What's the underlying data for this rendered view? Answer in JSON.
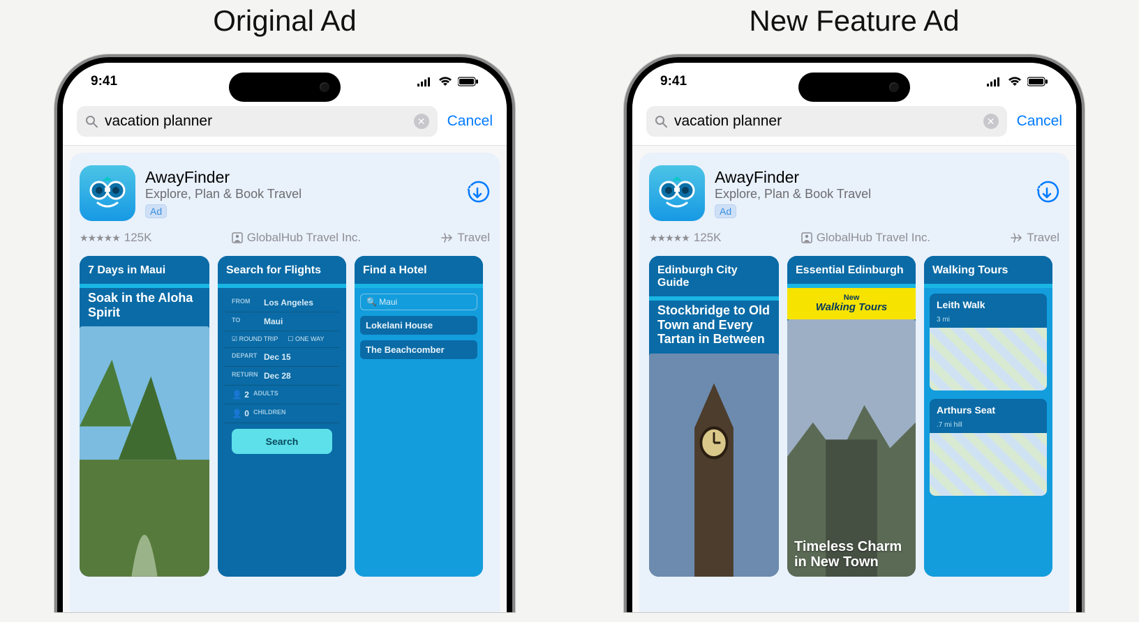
{
  "labels": {
    "left": "Original Ad",
    "right": "New Feature Ad"
  },
  "status": {
    "time": "9:41"
  },
  "search": {
    "query": "vacation planner",
    "cancel": "Cancel"
  },
  "app": {
    "name": "AwayFinder",
    "subtitle": "Explore, Plan & Book Travel",
    "ad_badge": "Ad",
    "ratings_count": "125K",
    "developer": "GlobalHub Travel Inc.",
    "category": "Travel"
  },
  "left_shots": {
    "s1": {
      "title": "7 Days in Maui",
      "subtitle": "Soak in the Aloha Spirit"
    },
    "s2": {
      "title": "Search for Flights",
      "from_label": "FROM",
      "from": "Los Angeles",
      "to_label": "TO",
      "to": "Maui",
      "round": "ROUND TRIP",
      "oneway": "ONE WAY",
      "depart_label": "DEPART",
      "depart": "Dec 15",
      "return_label": "RETURN",
      "return": "Dec 28",
      "adults_n": "2",
      "adults": "ADULTS",
      "kids_n": "0",
      "kids": "CHILDREN",
      "button": "Search"
    },
    "s3": {
      "title": "Find a Hotel",
      "search_term": "Maui",
      "hotel1": "Lokelani House",
      "hotel2": "The Beachcomber"
    }
  },
  "right_shots": {
    "s1": {
      "title": "Edinburgh City Guide",
      "subtitle": "Stockbridge to Old Town and Every Tartan in Between"
    },
    "s2": {
      "title": "Essential Edinburgh",
      "band_small": "New",
      "band": "Walking Tours",
      "overlay": "Timeless Charm in New Town"
    },
    "s3": {
      "title": "Walking Tours",
      "place1": "Leith Walk",
      "place1_sub": "3 mi",
      "place2": "Arthurs Seat",
      "place2_sub": ".7 mi hill"
    }
  }
}
